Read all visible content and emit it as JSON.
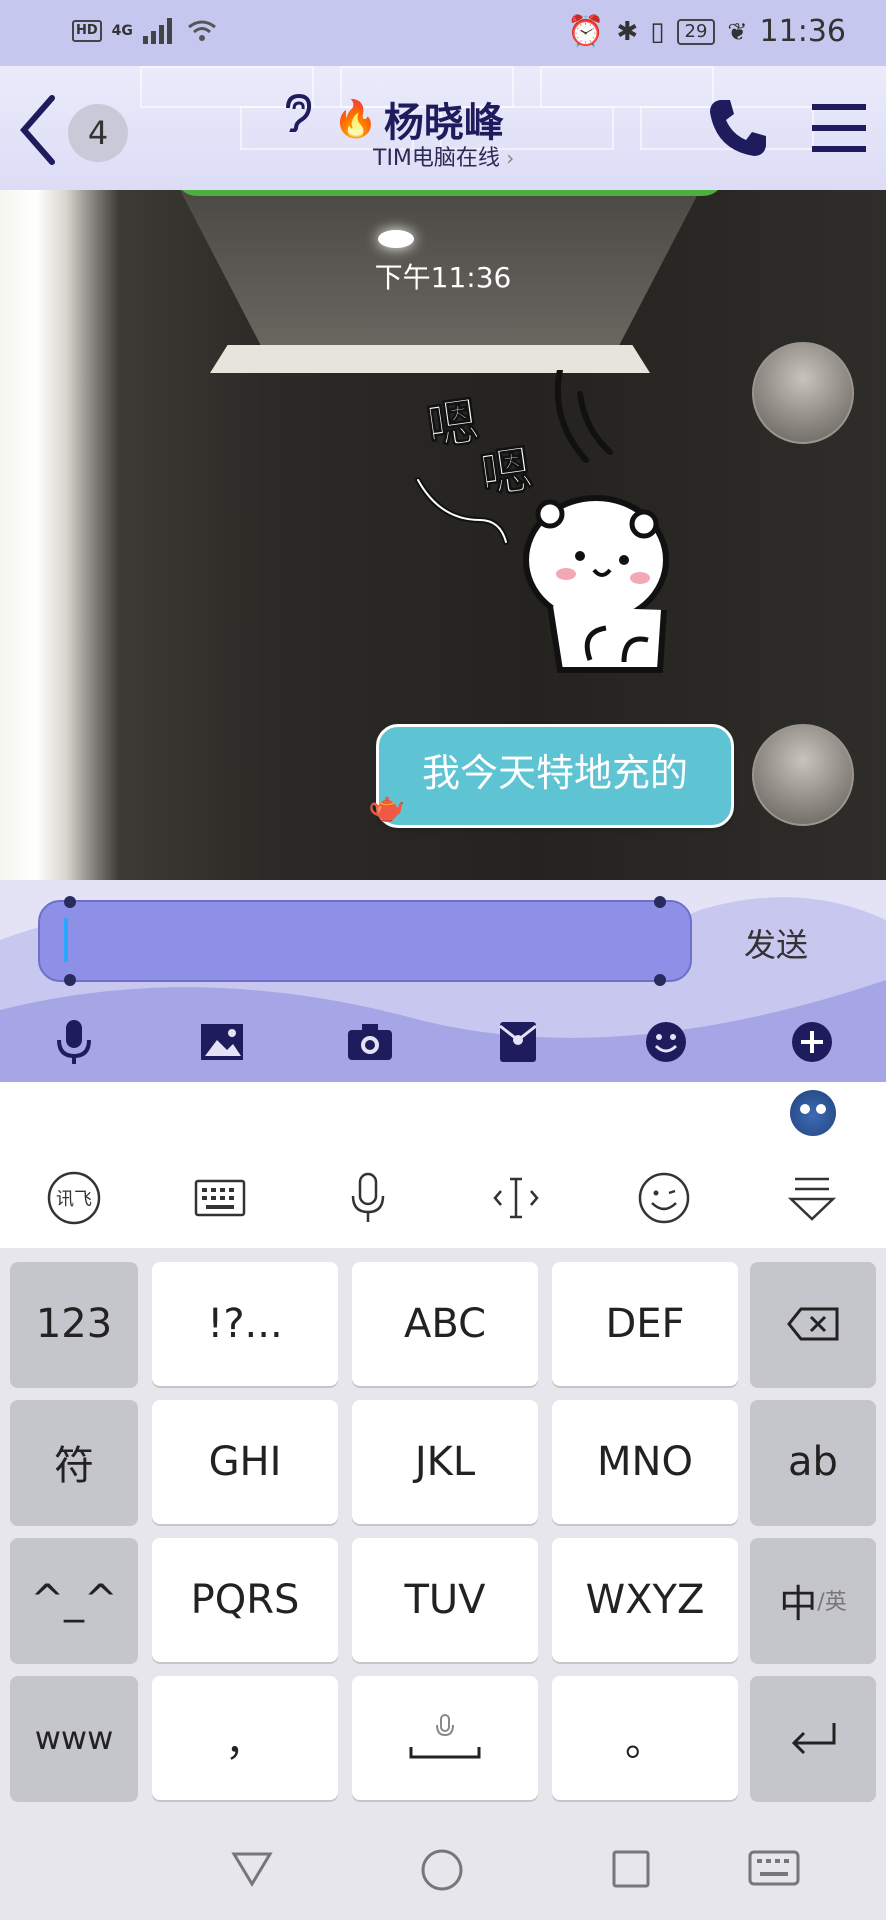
{
  "status_bar": {
    "hd": "HD",
    "network": "4G",
    "battery": "29",
    "time": "11:36"
  },
  "header": {
    "unread_count": "4",
    "title": "杨晓峰",
    "subtitle": "TIM电脑在线",
    "title_emoji": "🔥"
  },
  "chat": {
    "timestamp": "下午11:36",
    "sticker_text": "嗯嗯",
    "message": "我今天特地充的"
  },
  "input": {
    "value": "",
    "send_label": "发送"
  },
  "toolbar": [
    "voice-icon",
    "image-icon",
    "camera-icon",
    "red-packet-icon",
    "emoji-icon",
    "plus-icon"
  ],
  "keyboard": {
    "rows": [
      [
        "123",
        "!?...",
        "ABC",
        "DEF",
        "⌫"
      ],
      [
        "符",
        "GHI",
        "JKL",
        "MNO",
        "ab"
      ],
      [
        "^_^",
        "PQRS",
        "TUV",
        "WXYZ",
        "中/英"
      ],
      [
        "www",
        "，",
        "␣",
        "。",
        "↵"
      ]
    ],
    "lang_main": "中",
    "lang_sub": "/英"
  },
  "colors": {
    "accent": "#8e90e8",
    "bubble": "#5ec4d4",
    "header_text": "#1f1c5e"
  }
}
